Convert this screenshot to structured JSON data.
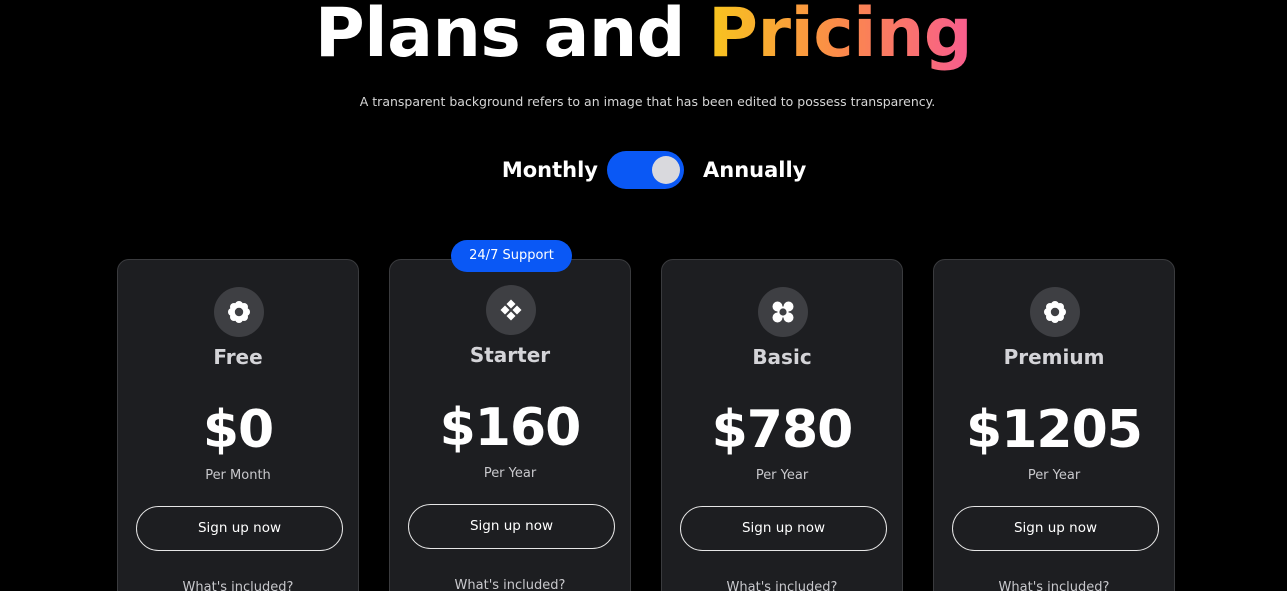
{
  "header": {
    "title_part1": "Plans and ",
    "title_part2": "Pricing",
    "subtitle": "A transparent background refers to an image that has been edited to possess transparency."
  },
  "billing_toggle": {
    "left_label": "Monthly",
    "right_label": "Annually",
    "state": "annually",
    "accent": "#0a58f5"
  },
  "badge": {
    "label": "24/7 Support"
  },
  "plans": [
    {
      "name": "Free",
      "icon": "flower-icon",
      "price": "$0",
      "period": "Per Month",
      "cta": "Sign up now",
      "included": "What's included?"
    },
    {
      "name": "Starter",
      "icon": "diamond-grid-icon",
      "price": "$160",
      "period": "Per Year",
      "cta": "Sign up now",
      "included": "What's included?"
    },
    {
      "name": "Basic",
      "icon": "clover-icon",
      "price": "$780",
      "period": "Per Year",
      "cta": "Sign up now",
      "included": "What's included?"
    },
    {
      "name": "Premium",
      "icon": "flower-icon",
      "price": "$1205",
      "period": "Per Year",
      "cta": "Sign up now",
      "included": "What's included?"
    }
  ],
  "colors": {
    "background": "#000000",
    "card": "#1d1e21",
    "gradient_start": "#f7c51e",
    "gradient_end": "#f85c8f"
  }
}
